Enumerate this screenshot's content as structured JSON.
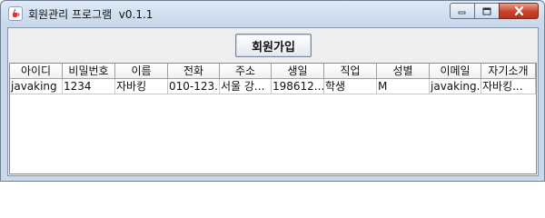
{
  "window": {
    "title": "회원관리 프로그램  v0.1.1"
  },
  "top_panel": {
    "join_button_label": "회원가입"
  },
  "table": {
    "columns": [
      "아이디",
      "비밀번호",
      "이름",
      "전화",
      "주소",
      "생일",
      "직업",
      "성별",
      "이메일",
      "자기소개"
    ],
    "rows": [
      [
        "javaking",
        "1234",
        "자바킹",
        "010-123...",
        "서울 강...",
        "198612...",
        "학생",
        "M",
        "javaking...",
        "자바킹..."
      ]
    ]
  },
  "icons": {
    "app_icon": "java-cup-icon",
    "minimize": "minimize-icon",
    "maximize": "maximize-icon",
    "close": "close-icon"
  },
  "colors": {
    "window_frame": "#c9d9ea",
    "close_button": "#c8432a",
    "panel_background": "#eeeeee"
  }
}
